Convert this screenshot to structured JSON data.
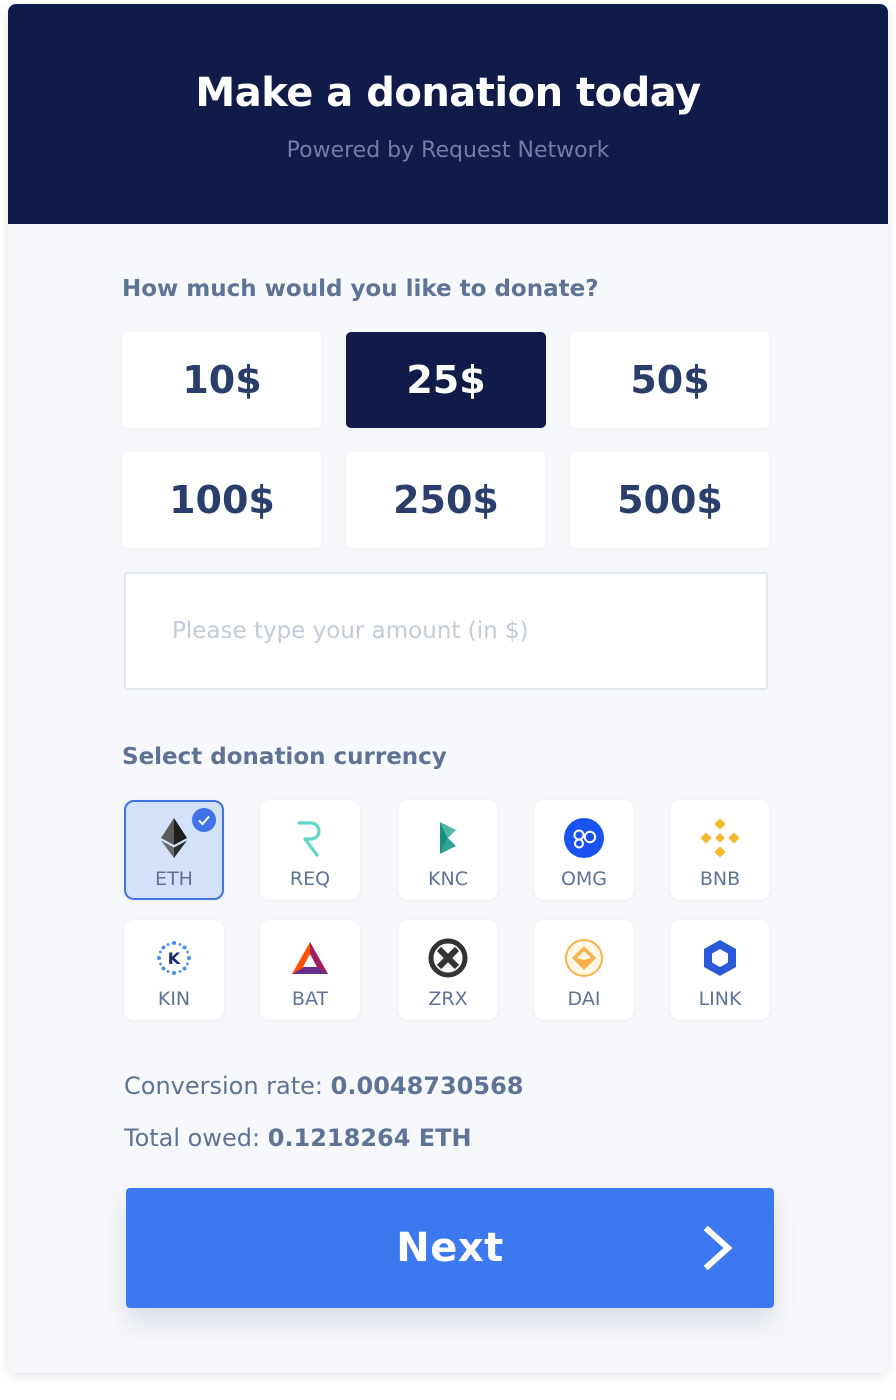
{
  "header": {
    "title": "Make a donation today",
    "subtitle": "Powered by Request Network"
  },
  "amount_section": {
    "label": "How much would you like to donate?",
    "options": [
      {
        "label": "10$",
        "selected": false
      },
      {
        "label": "25$",
        "selected": true
      },
      {
        "label": "50$",
        "selected": false
      },
      {
        "label": "100$",
        "selected": false
      },
      {
        "label": "250$",
        "selected": false
      },
      {
        "label": "500$",
        "selected": false
      }
    ],
    "custom_placeholder": "Please type your amount (in $)",
    "custom_value": ""
  },
  "currency_section": {
    "label": "Select donation currency",
    "selected": "ETH",
    "currencies": [
      {
        "code": "ETH",
        "icon": "ethereum-icon"
      },
      {
        "code": "REQ",
        "icon": "request-icon"
      },
      {
        "code": "KNC",
        "icon": "kyber-icon"
      },
      {
        "code": "OMG",
        "icon": "omisego-icon"
      },
      {
        "code": "BNB",
        "icon": "binance-icon"
      },
      {
        "code": "KIN",
        "icon": "kin-icon"
      },
      {
        "code": "BAT",
        "icon": "bat-icon"
      },
      {
        "code": "ZRX",
        "icon": "zrx-icon"
      },
      {
        "code": "DAI",
        "icon": "dai-icon"
      },
      {
        "code": "LINK",
        "icon": "chainlink-icon"
      }
    ]
  },
  "summary": {
    "conversion_label": "Conversion rate:",
    "conversion_value": "0.0048730568",
    "total_label": "Total owed:",
    "total_value": "0.1218264 ETH"
  },
  "next_button": {
    "label": "Next",
    "icon": "chevron-right-icon"
  },
  "colors": {
    "header_bg": "#111b49",
    "accent": "#3c78f0",
    "selected_currency_bg": "#d4e1fb",
    "text_muted": "#5f7396"
  }
}
